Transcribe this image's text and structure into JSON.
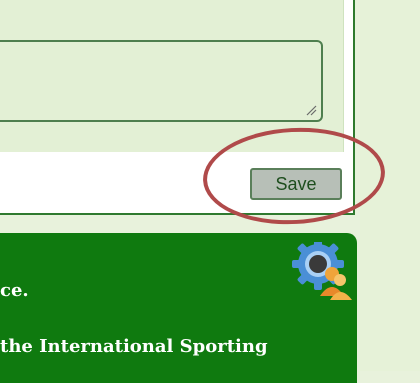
{
  "form": {
    "save_label": "Save"
  },
  "panel": {
    "line1": "ce.",
    "line2": "the International Sporting",
    "line3": "",
    "icon": "community-gear-icon"
  },
  "colors": {
    "accent_green": "#0f7a0f",
    "highlight_red": "#b04a4a",
    "button_gray": "#b7bfb7"
  }
}
